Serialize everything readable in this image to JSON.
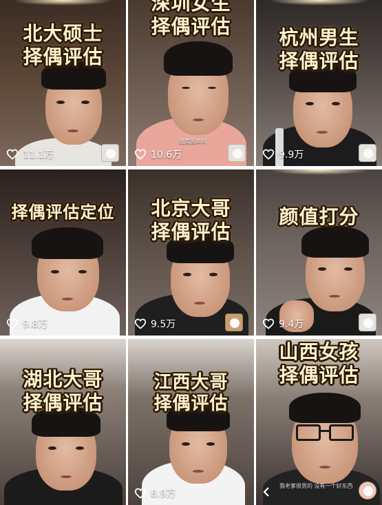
{
  "tiles": [
    {
      "title_line1": "北大硕士",
      "title_line2": "择偶评估",
      "likes": "11.1万"
    },
    {
      "title_line1": "深圳女生",
      "title_line2": "择偶评估",
      "likes": "10.6万",
      "caption": "我美国本科"
    },
    {
      "title_line1": "杭州男生",
      "title_line2": "择偶评估",
      "likes": "9.9万"
    },
    {
      "title_line1": "择偶评估定位",
      "title_line2": "",
      "likes": "9.8万"
    },
    {
      "title_line1": "北京大哥",
      "title_line2": "择偶评估",
      "likes": "9.5万"
    },
    {
      "title_line1": "颜值打分",
      "title_line2": "",
      "likes": "9.4万"
    },
    {
      "title_line1": "湖北大哥",
      "title_line2": "择偶评估",
      "likes": ""
    },
    {
      "title_line1": "江西大哥",
      "title_line2": "择偶评估",
      "likes": "8.9万"
    },
    {
      "title_line1": "山西女孩",
      "title_line2": "择偶评估",
      "likes": "",
      "caption": "我老爹很男的 没有一个好东西"
    }
  ],
  "icons": {
    "like": "heart-outline-icon",
    "back": "chevron-left-icon"
  },
  "colors": {
    "title_text": "#fff2cc",
    "title_outline": "#2b1a08",
    "likes_text": "#ffffff"
  }
}
